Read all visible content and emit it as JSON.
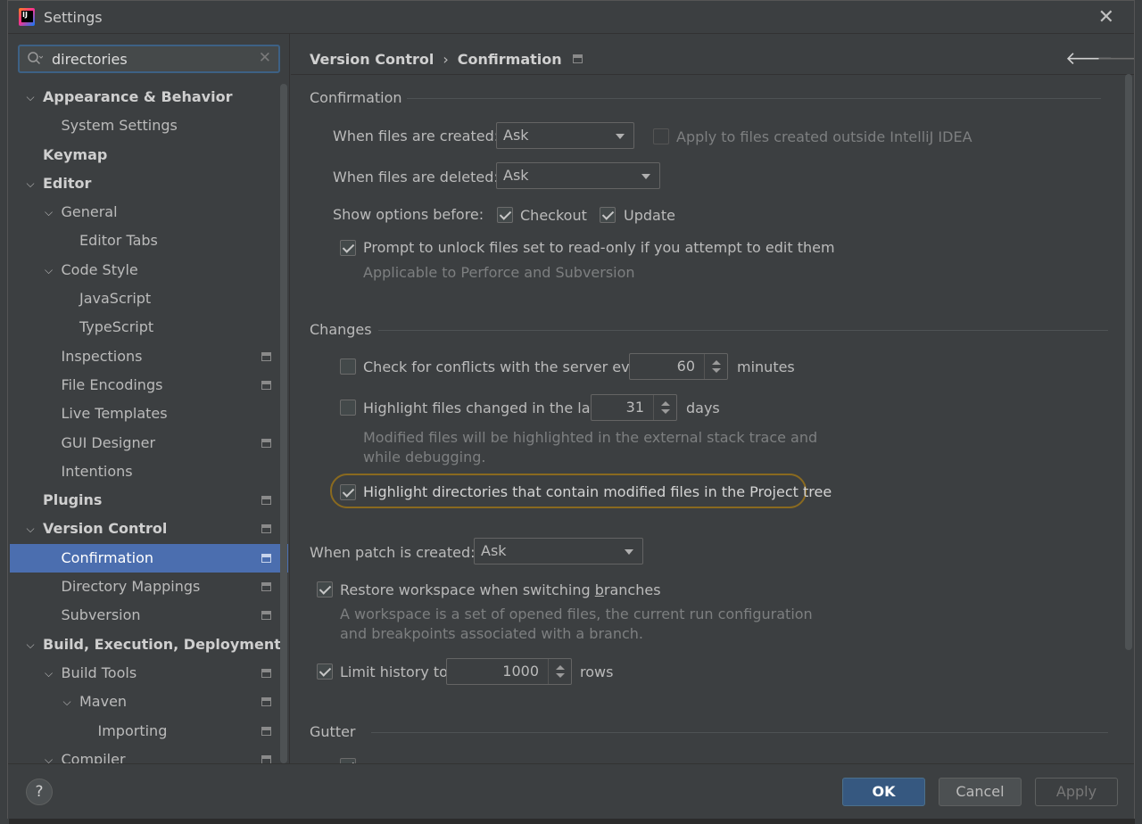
{
  "window": {
    "title": "Settings"
  },
  "search": {
    "value": "directories"
  },
  "tree": [
    {
      "label": "Appearance & Behavior",
      "level": 0,
      "arrow": "down",
      "bold": true,
      "badge": false
    },
    {
      "label": "System Settings",
      "level": 1,
      "arrow": "",
      "bold": false,
      "badge": false
    },
    {
      "label": "Keymap",
      "level": 0,
      "arrow": "",
      "bold": true,
      "badge": false
    },
    {
      "label": "Editor",
      "level": 0,
      "arrow": "down",
      "bold": true,
      "badge": false
    },
    {
      "label": "General",
      "level": 1,
      "arrow": "down",
      "bold": false,
      "badge": false
    },
    {
      "label": "Editor Tabs",
      "level": 2,
      "arrow": "",
      "bold": false,
      "badge": false
    },
    {
      "label": "Code Style",
      "level": 1,
      "arrow": "down",
      "bold": false,
      "badge": false
    },
    {
      "label": "JavaScript",
      "level": 2,
      "arrow": "",
      "bold": false,
      "badge": false
    },
    {
      "label": "TypeScript",
      "level": 2,
      "arrow": "",
      "bold": false,
      "badge": false
    },
    {
      "label": "Inspections",
      "level": 1,
      "arrow": "",
      "bold": false,
      "badge": true
    },
    {
      "label": "File Encodings",
      "level": 1,
      "arrow": "",
      "bold": false,
      "badge": true
    },
    {
      "label": "Live Templates",
      "level": 1,
      "arrow": "",
      "bold": false,
      "badge": false
    },
    {
      "label": "GUI Designer",
      "level": 1,
      "arrow": "",
      "bold": false,
      "badge": true
    },
    {
      "label": "Intentions",
      "level": 1,
      "arrow": "",
      "bold": false,
      "badge": false
    },
    {
      "label": "Plugins",
      "level": 0,
      "arrow": "",
      "bold": true,
      "badge": true
    },
    {
      "label": "Version Control",
      "level": 0,
      "arrow": "down",
      "bold": true,
      "badge": true
    },
    {
      "label": "Confirmation",
      "level": 1,
      "arrow": "",
      "bold": false,
      "badge": true,
      "selected": true
    },
    {
      "label": "Directory Mappings",
      "level": 1,
      "arrow": "",
      "bold": false,
      "badge": true
    },
    {
      "label": "Subversion",
      "level": 1,
      "arrow": "",
      "bold": false,
      "badge": true
    },
    {
      "label": "Build, Execution, Deployment",
      "level": 0,
      "arrow": "down",
      "bold": true,
      "badge": false
    },
    {
      "label": "Build Tools",
      "level": 1,
      "arrow": "down",
      "bold": false,
      "badge": true
    },
    {
      "label": "Maven",
      "level": 2,
      "arrow": "down",
      "bold": false,
      "badge": true
    },
    {
      "label": "Importing",
      "level": 3,
      "arrow": "",
      "bold": false,
      "badge": true
    },
    {
      "label": "Compiler",
      "level": 1,
      "arrow": "down",
      "bold": false,
      "badge": true
    }
  ],
  "breadcrumb": {
    "parent": "Version Control",
    "sep": "›",
    "current": "Confirmation"
  },
  "confirmation": {
    "title": "Confirmation",
    "created_label": "When files are created:",
    "created_value": "Ask",
    "apply_outside_label": "Apply to files created outside IntelliJ IDEA",
    "apply_outside_checked": false,
    "deleted_label": "When files are deleted:",
    "deleted_value": "Ask",
    "show_options_label": "Show options before:",
    "checkout_label": "Checkout",
    "checkout_checked": true,
    "update_label": "Update",
    "update_checked": true,
    "prompt_unlock_label": "Prompt to unlock files set to read-only if you attempt to edit them",
    "prompt_unlock_checked": true,
    "prompt_unlock_hint": "Applicable to Perforce and Subversion"
  },
  "changes": {
    "title": "Changes",
    "conflicts_label": "Check for conflicts with the server every",
    "conflicts_checked": false,
    "conflicts_value": "60",
    "conflicts_unit": "minutes",
    "highlight_changed_label": "Highlight files changed in the last",
    "highlight_changed_checked": false,
    "highlight_changed_value": "31",
    "highlight_changed_unit": "days",
    "highlight_hint_1": "Modified files will be highlighted in the external stack trace and",
    "highlight_hint_2": "while debugging.",
    "highlight_dirs_label": "Highlight directories that contain modified files in the Project tree",
    "highlight_dirs_checked": true
  },
  "patch": {
    "label": "When patch is created:",
    "value": "Ask"
  },
  "restore": {
    "label_pre": "Restore workspace when switching ",
    "label_mnemonic": "b",
    "label_post": "ranches",
    "checked": true,
    "hint_1": "A workspace is a set of opened files, the current run configuration",
    "hint_2": "and breakpoints associated with a branch."
  },
  "history": {
    "label": "Limit history to",
    "value": "1000",
    "unit": "rows",
    "checked": true
  },
  "gutter": {
    "title": "Gutter"
  },
  "footer": {
    "help": "?",
    "ok": "OK",
    "cancel": "Cancel",
    "apply": "Apply"
  },
  "colors": {
    "selection": "#4b6eaf",
    "highlight_ring": "#8a6a1f",
    "primary_button": "#365880"
  }
}
